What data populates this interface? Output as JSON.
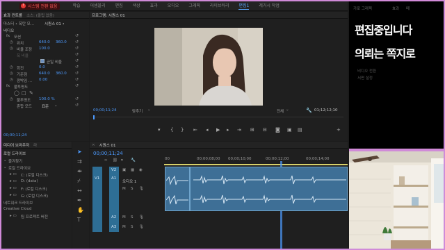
{
  "topbar": {
    "rec_label": "시스템 전환 없음",
    "menu": [
      "학습",
      "어셈블리",
      "편집",
      "색상",
      "효과",
      "오디오",
      "그래픽",
      "라이브러리",
      "편집1",
      "레거시 작업"
    ],
    "active_menu": "편집1"
  },
  "effect_controls": {
    "tabs": [
      "효과 컨트롤",
      "소스: (클립 없음)"
    ],
    "master_label": "마스터 • 폭탄 모...",
    "sequence_label": "시퀀스 01 •",
    "section_video": "비디오",
    "motion": "모션",
    "position_label": "위치",
    "position_x": "640.0",
    "position_y": "360.0",
    "scale_label": "비율 조정",
    "scale_value": "100.0",
    "scale_width_label": "폭 비율",
    "uniform_scale_label": "균일 비율",
    "rotation_label": "회전",
    "rotation_value": "0.0",
    "anchor_label": "기준점",
    "anchor_x": "640.0",
    "anchor_y": "360.0",
    "flicker_label": "깜박임 ...",
    "flicker_value": "0.00",
    "opacity_section": "불투명도",
    "opacity_label": "불투명도",
    "opacity_value": "100.0 %",
    "blend_label": "혼합 모드",
    "blend_value": "표준",
    "timecode": "00;00;11;24"
  },
  "program": {
    "title": "프로그램: 시퀀스 01",
    "timecode": "00;00;11;24",
    "fit_label": "맞추기",
    "quality_label": "전체",
    "duration": "01;12;12;10"
  },
  "project": {
    "tabs": [
      "미디어 브라우저",
      "라"
    ],
    "location_label": "로컬 드라이브",
    "items": [
      "즐겨찾기",
      "로컬 드라이브",
      "C: (로컬 디스크)",
      "D: (data)",
      "F: (로컬 디스크)",
      "G: (로컬 디스크)",
      "네트워크 드라이브",
      "Creative Cloud",
      "팀 프로젝트 버전"
    ]
  },
  "timeline": {
    "title": "시퀀스 01",
    "timecode": "00;00;11;24",
    "ruler": [
      "00",
      "00;00;08;00",
      "00;00;10;00",
      "00;00;12;00",
      "00;00;14;00"
    ],
    "tracks": [
      "V2",
      "V1",
      "A1",
      "A2",
      "A3"
    ],
    "clip_label": "오디오 1"
  },
  "overlay_text": {
    "line1": "편집중입니다",
    "line2": "의뢰는 쪽지로",
    "tabs": [
      "가로 그래픽",
      "효과",
      "메"
    ],
    "items": [
      "비디오 전환",
      "서면 설정"
    ]
  },
  "colors": {
    "accent": "#4d9bff",
    "playhead": "#4d9bff",
    "clip": "#3e6f96",
    "frame": "#d08ad8",
    "record": "#e53935"
  }
}
